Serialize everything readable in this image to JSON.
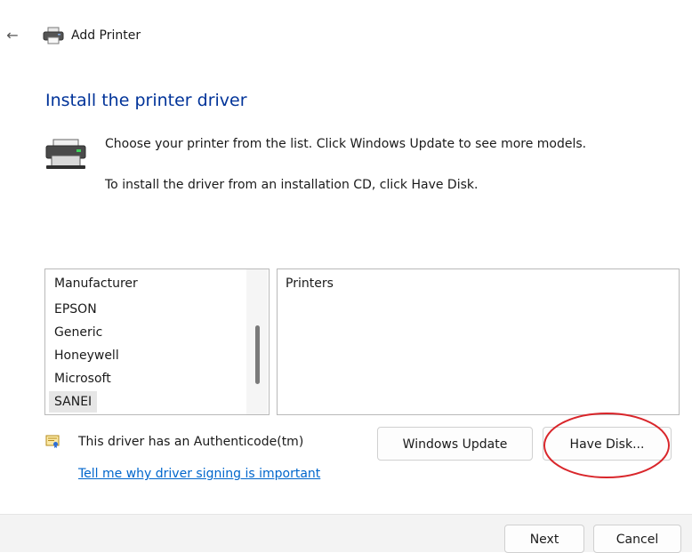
{
  "window": {
    "title": "Add Printer",
    "back_icon": "←"
  },
  "heading": "Install the printer driver",
  "description": {
    "line1": "Choose your printer from the list. Click Windows Update to see more models.",
    "line2": "To install the driver from an installation CD, click Have Disk."
  },
  "manufacturers": {
    "header": "Manufacturer",
    "items": [
      "EPSON",
      "Generic",
      "Honeywell",
      "Microsoft",
      "SANEI"
    ],
    "selected": "SANEI"
  },
  "printers": {
    "header": "Printers",
    "items": []
  },
  "signing": {
    "status": "This driver has an Authenticode(tm)",
    "link": "Tell me why driver signing is important"
  },
  "buttons": {
    "windows_update": "Windows Update",
    "have_disk": "Have Disk...",
    "next": "Next",
    "cancel": "Cancel"
  },
  "colors": {
    "heading": "#003399",
    "link": "#0066cc",
    "annotation": "#d9262b"
  },
  "icons": {
    "back": "arrow-left-icon",
    "title": "printer-icon",
    "large": "printer-icon",
    "certificate": "certificate-icon"
  }
}
